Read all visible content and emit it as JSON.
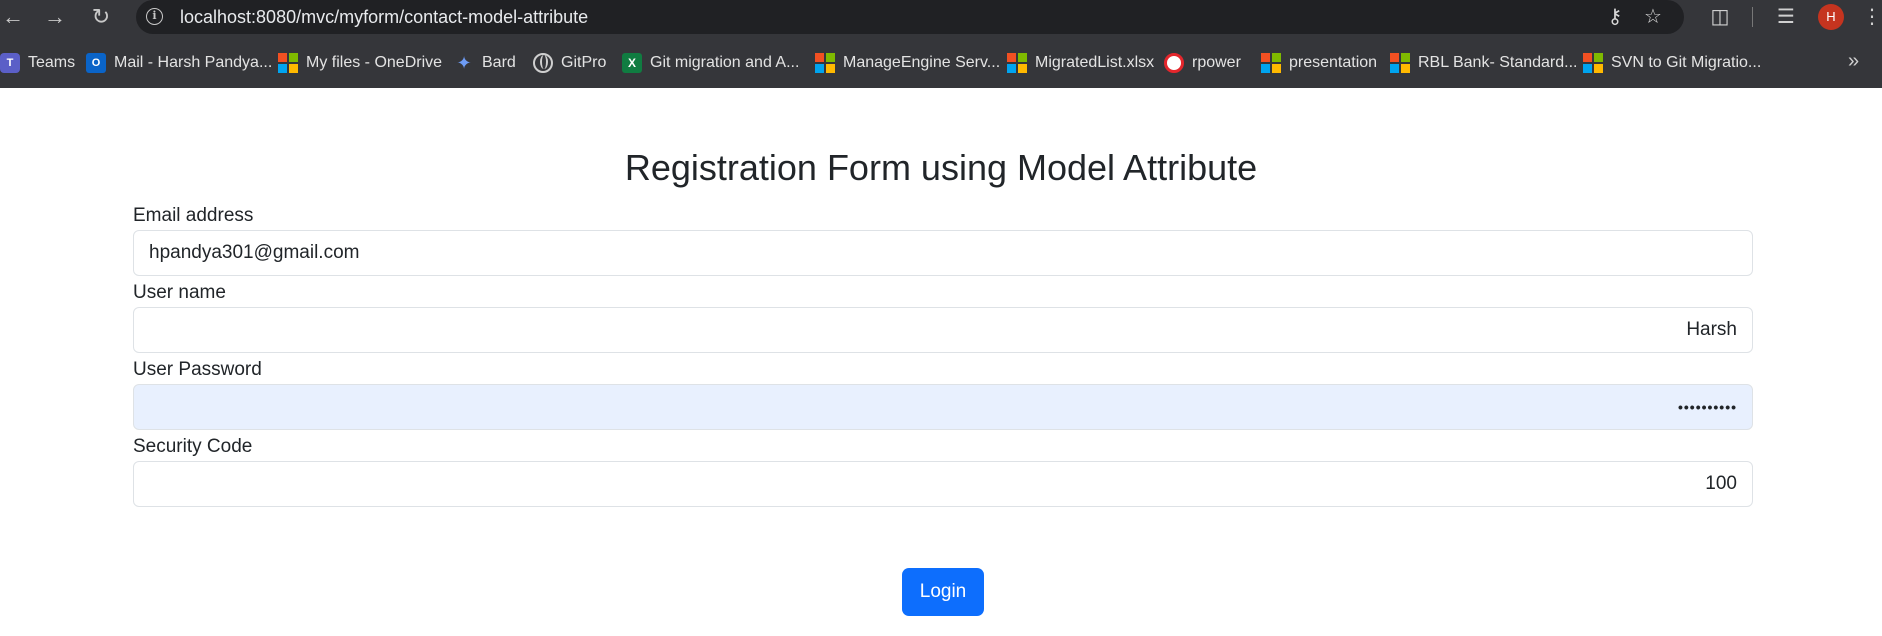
{
  "browser": {
    "url": "localhost:8080/mvc/myform/contact-model-attribute",
    "profile_initial": "H",
    "bookmarks": [
      {
        "label": "Teams",
        "icon": "teams-icon"
      },
      {
        "label": "Mail - Harsh Pandya...",
        "icon": "outlook-icon"
      },
      {
        "label": "My files - OneDrive",
        "icon": "microsoft-icon"
      },
      {
        "label": "Bard",
        "icon": "bard-sparkle-icon"
      },
      {
        "label": "GitPro",
        "icon": "globe-icon"
      },
      {
        "label": "Git migration and A...",
        "icon": "excel-icon"
      },
      {
        "label": "ManageEngine Serv...",
        "icon": "microsoft-icon"
      },
      {
        "label": "MigratedList.xlsx",
        "icon": "microsoft-icon"
      },
      {
        "label": "rpower",
        "icon": "oracle-icon"
      },
      {
        "label": "presentation",
        "icon": "microsoft-icon"
      },
      {
        "label": "RBL Bank- Standard...",
        "icon": "microsoft-icon"
      },
      {
        "label": "SVN to Git Migratio...",
        "icon": "microsoft-icon"
      }
    ]
  },
  "form": {
    "title": "Registration Form using Model Attribute",
    "email_label": "Email address",
    "email_value": "hpandya301@gmail.com",
    "username_label": "User name",
    "username_value": "Harsh",
    "password_label": "User Password",
    "password_value": "••••••••••",
    "security_label": "Security Code",
    "security_value": "100",
    "submit_label": "Login"
  },
  "colors": {
    "chrome_bg": "#35363a",
    "omnibox_bg": "#202124",
    "primary_button": "#0d6efd",
    "autofill_bg": "#e8f0fe",
    "profile_avatar": "#c5341f"
  }
}
